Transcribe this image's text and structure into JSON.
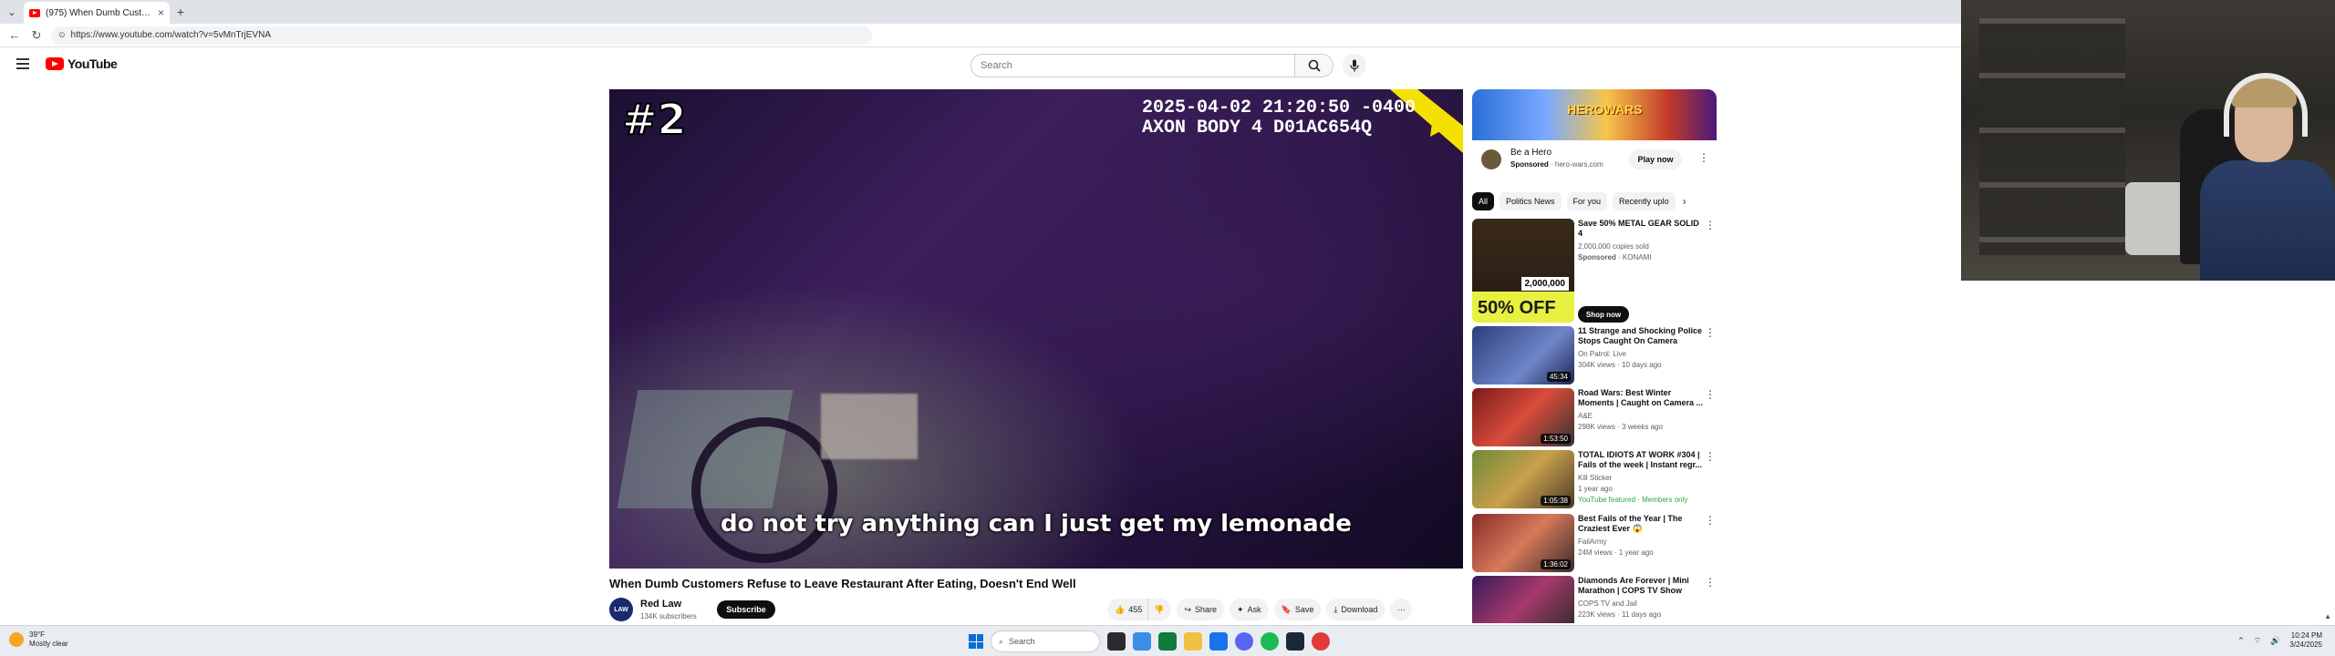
{
  "browser": {
    "tab_title": "(975) When Dumb Customers",
    "tab_close": "×",
    "new_tab": "+",
    "url": "https://www.youtube.com/watch?v=5vMnTrjEVNA"
  },
  "header": {
    "logo": "YouTube",
    "search_placeholder": "Search"
  },
  "player": {
    "episode": "#2",
    "timestamp_line1": "2025-04-02 21:20:50 -0400",
    "timestamp_line2": "AXON BODY 4 D01AC654Q",
    "caption": "do not try anything can I just get my lemonade"
  },
  "video": {
    "title": "When Dumb Customers Refuse to Leave Restaurant After Eating, Doesn't End Well",
    "channel": "Red Law",
    "avatar_text": "LAW",
    "subscribers": "134K subscribers",
    "subscribe_label": "Subscribe",
    "likes": "455",
    "share": "Share",
    "ask": "Ask",
    "save": "Save",
    "download": "Download"
  },
  "ad": {
    "banner_text": "HEROWARS",
    "title": "Be a Hero",
    "sponsored": "Sponsored",
    "domain": "hero-wars.com",
    "cta": "Play now"
  },
  "chips": [
    "All",
    "Politics News",
    "For you",
    "Recently uplo"
  ],
  "promo": {
    "title": "Save 50% METAL GEAR SOLID 4",
    "copies_sold": "2,000,000 copies sold",
    "sponsored": "Sponsored",
    "advertiser": "KONAMI",
    "off_text": "50% OFF",
    "badge": "2,000,000",
    "cta": "Shop now"
  },
  "recommendations": [
    {
      "title": "11 Strange and Shocking Police Stops Caught On Camera",
      "channel": "On Patrol: Live",
      "meta": "304K views · 10 days ago",
      "extra": "",
      "duration": "45:34"
    },
    {
      "title": "Road Wars: Best Winter Moments | Caught on Camera ...",
      "channel": "A&E",
      "meta": "298K views · 3 weeks ago",
      "extra": "",
      "duration": "1:53:50"
    },
    {
      "title": "TOTAL IDIOTS AT WORK #304 | Fails of the week | Instant regr...",
      "channel": "Kill Sticker",
      "meta": "1 year ago",
      "extra": "YouTube featured · Members only",
      "duration": "1:05:38"
    },
    {
      "title": "Best Fails of the Year | The Craziest Ever 😱",
      "channel": "FailArmy",
      "meta": "24M views · 1 year ago",
      "extra": "",
      "duration": "1:36:02"
    },
    {
      "title": "Diamonds Are Forever | Mini Marathon | COPS TV Show",
      "channel": "COPS TV and Jail",
      "meta": "223K views · 11 days ago",
      "extra": "",
      "duration": ""
    }
  ],
  "taskbar": {
    "temp": "39°F",
    "weather": "Mostly clear",
    "search": "Search",
    "time": "10:24 PM",
    "date": "3/24/2025"
  },
  "colors": {
    "youtube_red": "#ff0000",
    "caption_white": "#ffffff",
    "accent_yellow": "#f5e100"
  }
}
